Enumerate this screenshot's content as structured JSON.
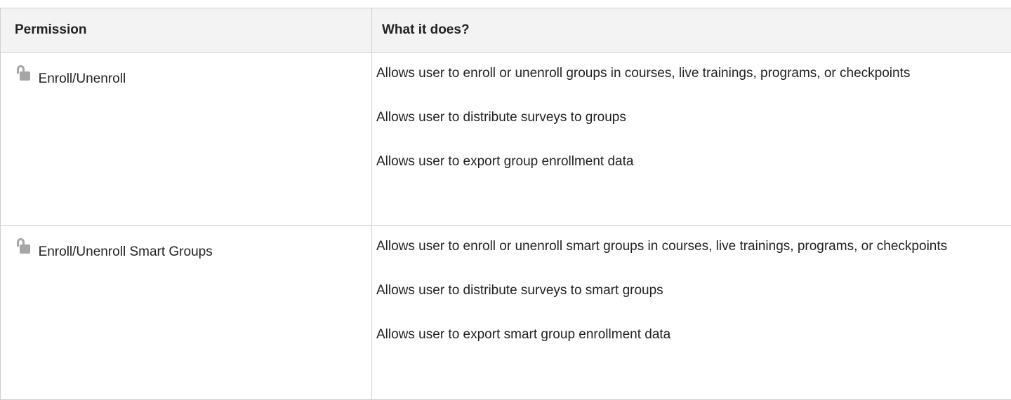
{
  "table": {
    "headers": {
      "permission": "Permission",
      "description": "What it does?"
    },
    "rows": [
      {
        "icon": "unlocked-padlock-icon",
        "permission": "Enroll/Unenroll",
        "descriptions": [
          "Allows user to enroll or unenroll groups in courses, live trainings, programs, or checkpoints",
          "Allows user to distribute surveys to groups",
          "Allows user to export group enrollment data"
        ]
      },
      {
        "icon": "unlocked-padlock-icon",
        "permission": "Enroll/Unenroll Smart Groups",
        "descriptions": [
          "Allows user to enroll or unenroll smart groups in courses, live trainings, programs, or checkpoints",
          "Allows user to distribute surveys to smart groups",
          "Allows user to export smart group enrollment data"
        ]
      }
    ]
  },
  "colors": {
    "header_bg": "#f3f3f3",
    "border": "#cfcfcf",
    "icon": "#a6a6a6",
    "text": "#222222"
  }
}
